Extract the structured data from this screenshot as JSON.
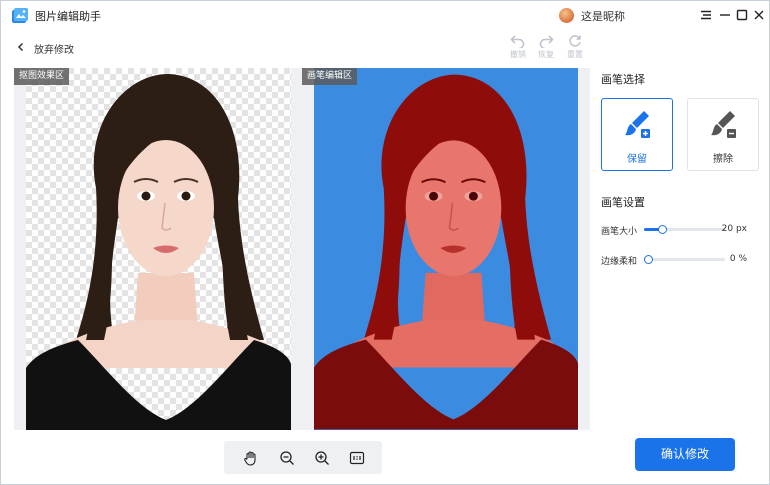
{
  "app": {
    "title": "图片编辑助手",
    "user_name": "这是昵称"
  },
  "toolbar": {
    "back_label": "放弃修改",
    "undo_label": "撤销",
    "redo_label": "恢复",
    "reset_label": "重置"
  },
  "canvas": {
    "left_label": "抠图效果区",
    "right_label": "画笔编辑区"
  },
  "brush": {
    "section_title": "画笔选择",
    "keep_label": "保留",
    "erase_label": "擦除",
    "selected": "keep"
  },
  "settings": {
    "section_title": "画笔设置",
    "size_label": "画笔大小",
    "size_value": "20 px",
    "size_level": 0.2,
    "feather_label": "边缘柔和",
    "feather_value": "0 %",
    "feather_level": 0.0
  },
  "actions": {
    "confirm_label": "确认修改"
  },
  "colors": {
    "accent": "#1a73e8",
    "mask_bg": "#3b8be0",
    "mask_overlay": "#b3100e"
  }
}
